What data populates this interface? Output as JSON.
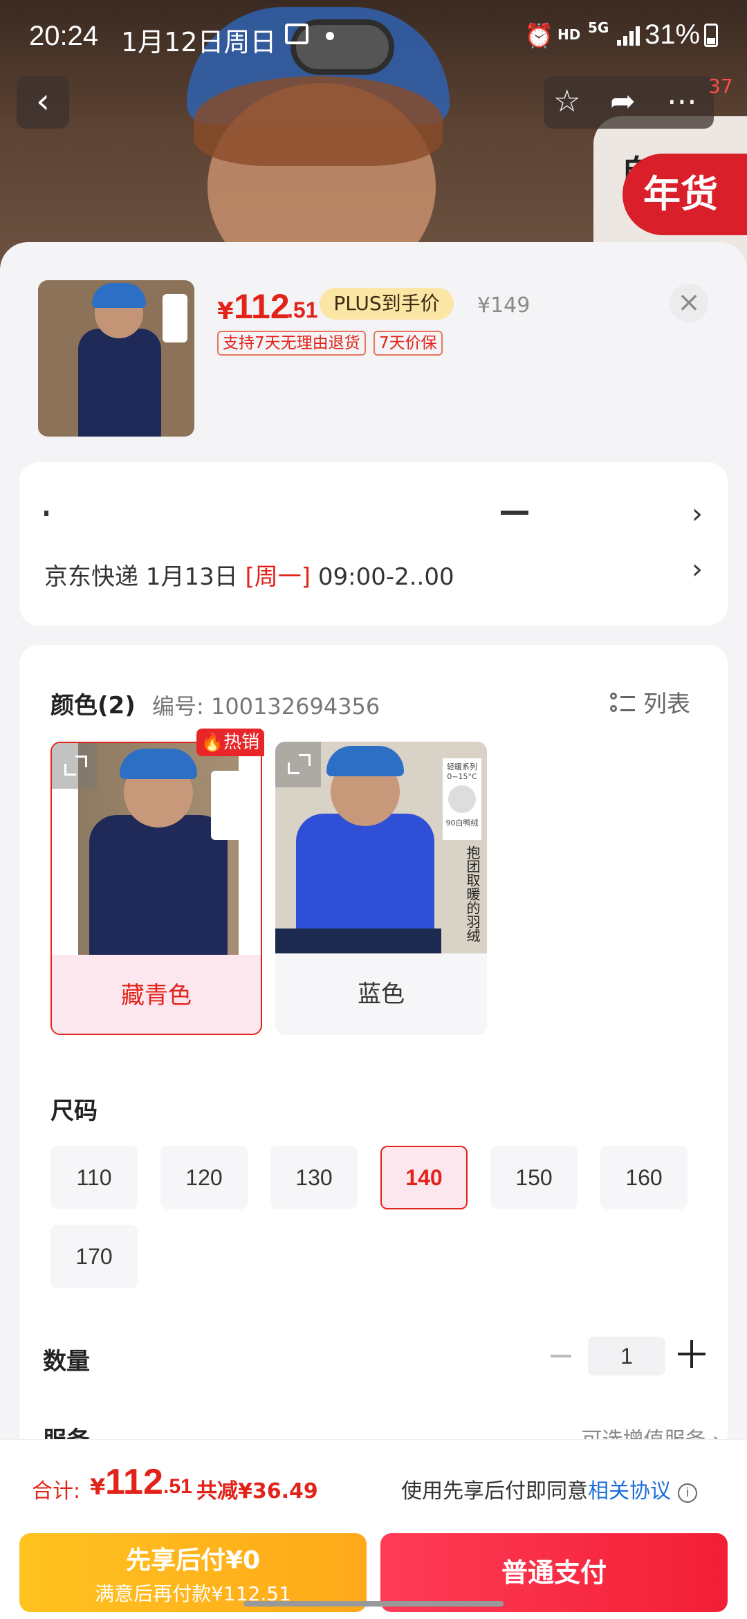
{
  "status_bar": {
    "time": "20:24",
    "date": "1月12日周日",
    "alarm": "⏰",
    "hd": "HD",
    "network": "5G",
    "battery": "31%"
  },
  "nav": {
    "back": "‹",
    "favorite": "☆",
    "share": "➦",
    "more": "⋯",
    "badge_count": "37",
    "promo_char": "自",
    "promo_badge": "年货节"
  },
  "product": {
    "price_symbol": "¥",
    "price_int": "112",
    "price_dec": ".51",
    "plus_label": "PLUS到手价",
    "original_price": "¥149",
    "tags": [
      "支持7天无理由退货",
      "7天价保"
    ],
    "close": "×"
  },
  "delivery": {
    "line2_prefix": "京东快递 1月13日 ",
    "line2_day": "[周一]",
    "line2_suffix": " 09:00-2..00",
    "chevron": "›"
  },
  "color_section": {
    "title": "颜色(2)",
    "sku": "编号: 100132694356",
    "list_label": "列表",
    "hot_label": "🔥热销",
    "options": [
      "藏青色",
      "蓝色"
    ],
    "tag_lines": [
      "轻暖系列",
      "0~15°C",
      "90白鸭绒"
    ],
    "vertical_text": "抱团取暖的羽绒"
  },
  "size_section": {
    "title": "尺码",
    "sizes": [
      "110",
      "120",
      "130",
      "140",
      "150",
      "160",
      "170"
    ],
    "selected": "140"
  },
  "quantity": {
    "title": "数量",
    "value": "1"
  },
  "service": {
    "title": "服务",
    "hint": "可选增值服务 ›"
  },
  "footer": {
    "total_label": "合计:",
    "total_symbol": "¥",
    "total_int": "112",
    "total_dec": ".51",
    "discount": "共减¥36.49",
    "agree_text": "使用先享后付即同意",
    "agree_link": "相关协议",
    "info": "i",
    "pay_later_title": "先享后付¥0",
    "pay_later_sub": "满意后再付款¥112.51",
    "pay_normal": "普通支付"
  },
  "colors": {
    "accent_red": "#e2231a",
    "link_blue": "#1e6fd9",
    "pay_later": "#ffb41c",
    "pay_normal": "#f5283f"
  }
}
